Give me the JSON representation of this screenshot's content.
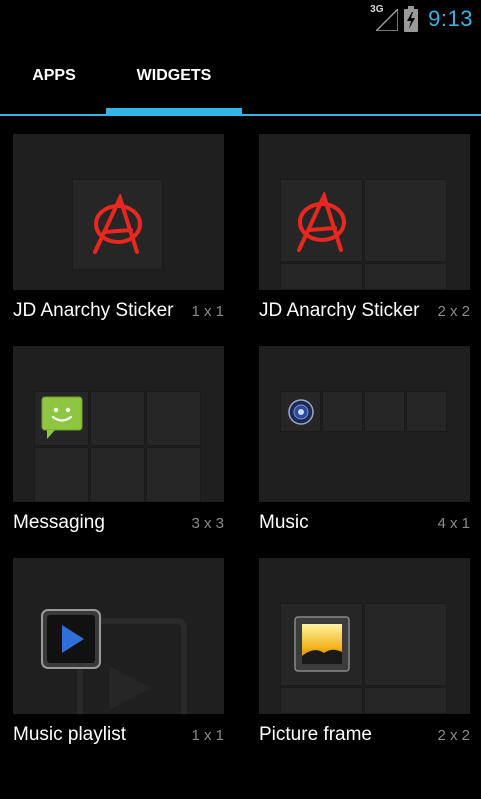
{
  "status_bar": {
    "network_label": "3G",
    "time": "9:13"
  },
  "tabs": [
    {
      "label": "APPS",
      "selected": false
    },
    {
      "label": "WIDGETS",
      "selected": true
    }
  ],
  "widgets": [
    {
      "name": "JD Anarchy Sticker",
      "size": "1 x 1",
      "icon": "anarchy-icon"
    },
    {
      "name": "JD Anarchy Sticker",
      "size": "2 x 2",
      "icon": "anarchy-icon"
    },
    {
      "name": "Messaging",
      "size": "3 x 3",
      "icon": "messaging-icon"
    },
    {
      "name": "Music",
      "size": "4 x 1",
      "icon": "speaker-icon"
    },
    {
      "name": "Music playlist",
      "size": "1 x 1",
      "icon": "play-icon"
    },
    {
      "name": "Picture frame",
      "size": "2 x 2",
      "icon": "picture-icon"
    }
  ],
  "colors": {
    "accent": "#33b5e5",
    "background": "#000000",
    "preview_bg": "#1f1f1f",
    "anarchy_red": "#e8281e",
    "messaging_green": "#8ec641"
  }
}
